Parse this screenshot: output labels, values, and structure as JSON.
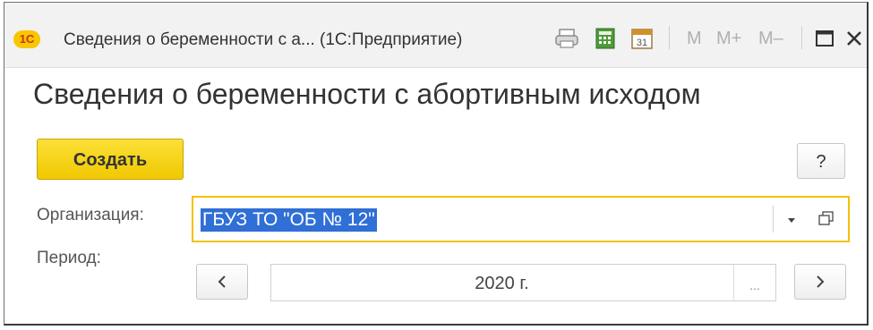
{
  "window": {
    "logo_text": "1С",
    "title": "Сведения о беременности с а... (1С:Предприятие)",
    "toolbar": {
      "icons": [
        "print-icon",
        "calculator-icon",
        "calendar-icon"
      ],
      "memory": [
        "M",
        "M+",
        "M–"
      ],
      "calendar_day": "31"
    },
    "controls": [
      "maximize-icon",
      "close-icon"
    ]
  },
  "form": {
    "heading": "Сведения о беременности с абортивным исходом",
    "create_label": "Создать",
    "help_label": "?",
    "organization_label": "Организация:",
    "organization_value": "ГБУЗ ТО \"ОБ № 12\"",
    "period_label": "Период:",
    "period_value": "2020 г.",
    "period_more": "...",
    "prev_symbol": "<",
    "next_symbol": ">"
  },
  "colors": {
    "accent_yellow": "#f1c800",
    "selection_blue": "#2f6fd6",
    "logo_red": "#d32f1e"
  }
}
